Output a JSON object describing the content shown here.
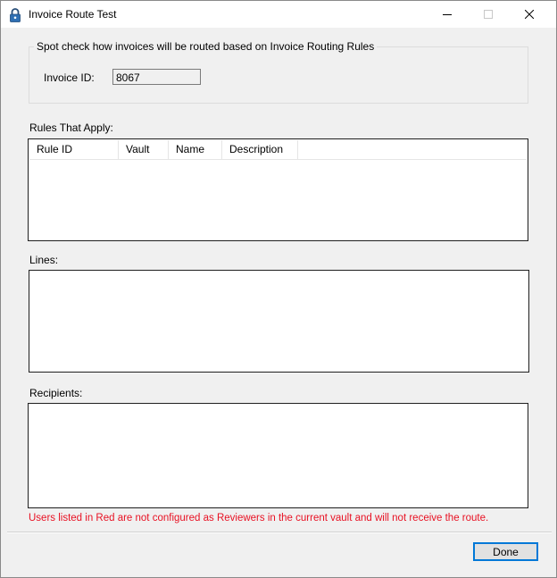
{
  "window": {
    "title": "Invoice Route Test"
  },
  "spot_check": {
    "legend": "Spot check how invoices will be routed based on Invoice Routing Rules",
    "invoice_id_label": "Invoice ID:",
    "invoice_id_value": "8067"
  },
  "rules": {
    "label": "Rules That Apply:",
    "columns": [
      "Rule ID",
      "Vault",
      "Name",
      "Description"
    ],
    "rows": []
  },
  "lines": {
    "label": "Lines:",
    "items": []
  },
  "recipients": {
    "label": "Recipients:",
    "items": [],
    "warning": "Users listed in Red are not configured as Reviewers in the current vault and will not receive the route.",
    "warning_color": "#e81123"
  },
  "footer": {
    "done_label": "Done"
  }
}
